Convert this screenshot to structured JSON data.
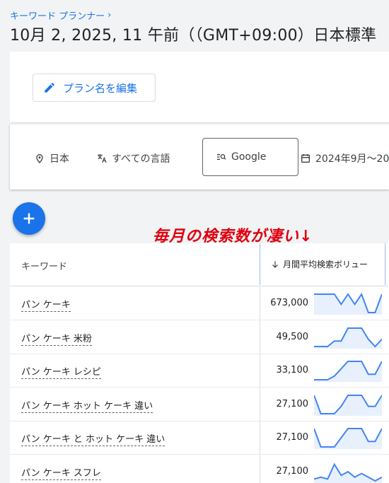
{
  "breadcrumb": {
    "label": "キーワード プランナー",
    "chevron": "›"
  },
  "page_title": "10月 2, 2025, 11 午前（（GMT+09:00）日本標準",
  "toolbar": {
    "edit_plan_label": "プラン名を編集"
  },
  "filters": {
    "location": "日本",
    "language": "すべての言語",
    "network": "Google",
    "date_range": "2024年9月～20"
  },
  "annotation": "毎月の検索数が凄い↓",
  "table": {
    "header_keyword": "キーワード",
    "header_volume": "月間平均検索ボリュー",
    "rows": [
      {
        "keyword": "パン ケーキ",
        "volume": "673,000",
        "trend": [
          1,
          1,
          1,
          1,
          0.45,
          1,
          0.45,
          1,
          0,
          0,
          1
        ]
      },
      {
        "keyword": "パン ケーキ 米粉",
        "volume": "49,500",
        "trend": [
          0,
          0,
          0,
          0.3,
          0.3,
          1,
          1,
          1,
          0.4,
          0,
          0.4
        ]
      },
      {
        "keyword": "パン ケーキ レシピ",
        "volume": "33,100",
        "trend": [
          0,
          0,
          0,
          0.2,
          0.6,
          1,
          1,
          1,
          0.3,
          0.3,
          1
        ]
      },
      {
        "keyword": "パン ケーキ ホット ケーキ 違い",
        "volume": "27,100",
        "trend": [
          1,
          0,
          0,
          0,
          0.4,
          1,
          1,
          1,
          0.4,
          0.4,
          1
        ]
      },
      {
        "keyword": "パン ケーキ と ホット ケーキ 違い",
        "volume": "27,100",
        "trend": [
          1,
          0,
          0,
          0,
          0.5,
          1,
          1,
          1,
          0.3,
          0.3,
          1
        ]
      },
      {
        "keyword": "パン ケーキ スフレ",
        "volume": "27,100",
        "trend": [
          0.1,
          0.2,
          0.1,
          0.9,
          0.3,
          0.5,
          0.2,
          0.4,
          0.2,
          0,
          0.2
        ]
      }
    ]
  },
  "colors": {
    "accent": "#1a73e8",
    "annotation": "#e0000f",
    "trend_fill": "#e8f0fe",
    "trend_line": "#4285f4"
  }
}
